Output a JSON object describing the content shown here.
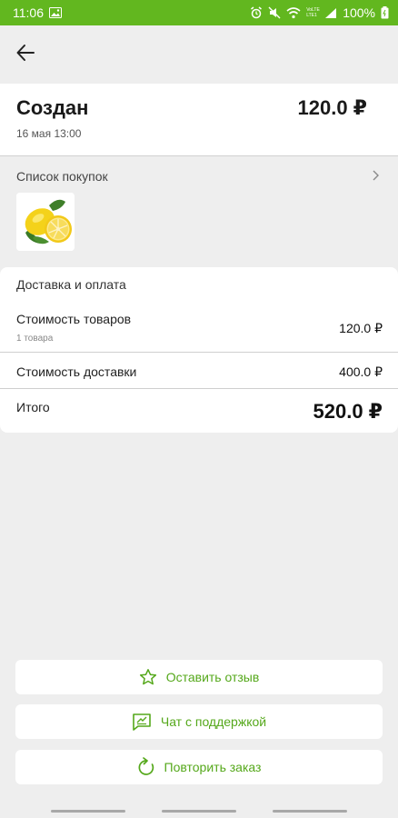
{
  "status_bar": {
    "time": "11:06",
    "battery": "100%",
    "wifi_label": "VoLTE LTE1"
  },
  "toolbar": {
    "back_icon": "arrow-left-icon"
  },
  "order": {
    "status": "Создан",
    "date": "16 мая 13:00",
    "total": "120.0 ₽"
  },
  "purchases": {
    "title": "Список покупок",
    "chevron_icon": "chevron-right-icon",
    "items": [
      {
        "image": "lemon-image"
      }
    ]
  },
  "payment": {
    "title": "Доставка и оплата",
    "goods_label": "Стоимость товаров",
    "goods_count": "1 товара",
    "goods_value": "120.0 ₽",
    "delivery_label": "Стоимость доставки",
    "delivery_value": "400.0 ₽",
    "total_label": "Итого",
    "total_value": "520.0 ₽"
  },
  "actions": {
    "review": {
      "label": "Оставить отзыв",
      "icon": "star-icon"
    },
    "support": {
      "label": "Чат с поддержкой",
      "icon": "chat-icon"
    },
    "repeat": {
      "label": "Повторить заказ",
      "icon": "refresh-icon"
    }
  },
  "colors": {
    "accent": "#62b71f",
    "accent_text": "#55a81b",
    "background": "#eeeeee"
  }
}
